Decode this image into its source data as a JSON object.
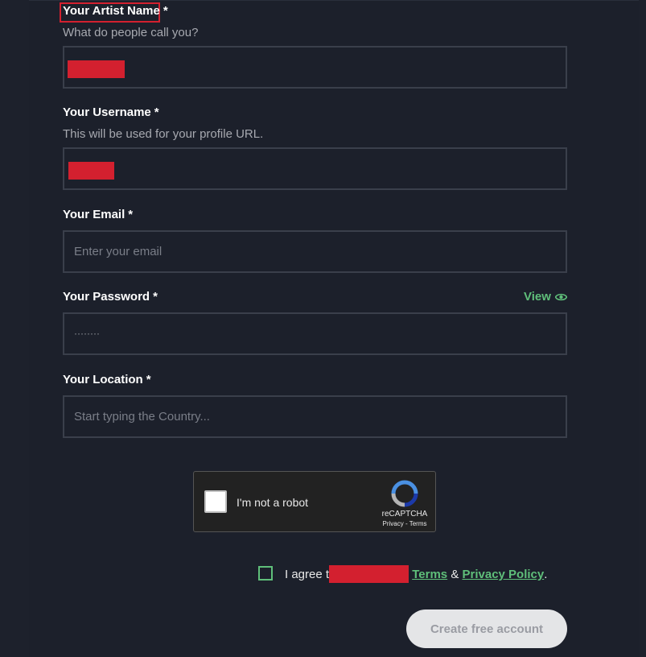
{
  "form": {
    "artist_name": {
      "label": "Your Artist Name",
      "required_mark": "*",
      "help": "What do people call you?"
    },
    "username": {
      "label": "Your Username",
      "required_mark": "*",
      "help": "This will be used for your profile URL."
    },
    "email": {
      "label": "Your Email",
      "required_mark": "*",
      "placeholder": "Enter your email"
    },
    "password": {
      "label": "Your Password",
      "required_mark": "*",
      "value": "········",
      "view_label": "View"
    },
    "location": {
      "label": "Your Location",
      "required_mark": "*",
      "placeholder": "Start typing the Country..."
    },
    "recaptcha": {
      "text": "I'm not a robot",
      "brand": "reCAPTCHA",
      "links": "Privacy - Terms"
    },
    "agree": {
      "prefix": "I agree t",
      "terms": "Terms",
      "and": "&",
      "privacy": "Privacy Policy",
      "suffix": "."
    },
    "submit_label": "Create free account"
  },
  "colors": {
    "background": "#1c202b",
    "accent": "#5fbf7a",
    "redaction": "#d3202f"
  }
}
